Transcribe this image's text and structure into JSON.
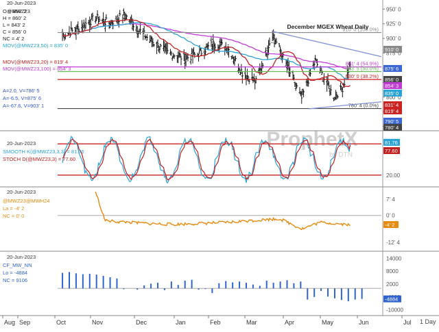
{
  "chart_data": [
    {
      "type": "candlestick",
      "panel": "price",
      "title": "December MGEX Wheat Daily",
      "date": "20-Jun-2023",
      "legend": [
        {
          "text": "@MWZ23",
          "color": "#222222"
        },
        {
          "text": "O = 860' 2",
          "color": "#222222"
        },
        {
          "text": "H = 860' 2",
          "color": "#222222"
        },
        {
          "text": "L = 843' 2",
          "color": "#222222"
        },
        {
          "text": "C = 856' 0",
          "color": "#222222"
        },
        {
          "text": "NC = 4' 2",
          "color": "#222222"
        },
        {
          "text": "MOV(@MWZ23,50) = 835' 0",
          "color": "#2aa3d6"
        },
        {
          "text": "MOV(@MWZ23,20) = 819' 4",
          "color": "#c02020"
        },
        {
          "text": "MOV(@MWZ23,100) = 854' 3",
          "color": "#c23ad6"
        },
        {
          "text": "A=2.0, V=786' 5",
          "color": "#3355cc"
        },
        {
          "text": "A=-6.5, V=875' 6",
          "color": "#3355cc"
        },
        {
          "text": "A=-67.6, V=903' 1",
          "color": "#3355cc"
        }
      ],
      "yticks": [
        "950' 0",
        "925' 0",
        "900' 0",
        "875' 0",
        "850' 0",
        "825' 0",
        "800' 0",
        "775' 0",
        "750' 0"
      ],
      "price_badges": [
        {
          "label": "910' 0",
          "color": "#888888"
        },
        {
          "label": "875' 6",
          "color": "#3a66d6"
        },
        {
          "label": "856' 0",
          "color": "#444444"
        },
        {
          "label": "854' 3",
          "color": "#c23ad6"
        },
        {
          "label": "835' 0",
          "color": "#2aa3d6"
        },
        {
          "label": "831' 4",
          "color": "#cc2222"
        },
        {
          "label": "819' 4",
          "color": "#cc2222"
        },
        {
          "label": "790' 5",
          "color": "#3a66d6"
        },
        {
          "label": "780' 4",
          "color": "#444444"
        }
      ],
      "fib_levels": [
        {
          "label": "910' 0 (100.0%)",
          "value": 910.0,
          "color": "#888888"
        },
        {
          "label": "851' 4 (54.9%)",
          "value": 851.5,
          "color": "#c23ad6"
        },
        {
          "label": "843' 5 (50.0%)",
          "value": 843.6,
          "color": "#66bb55"
        },
        {
          "label": "830' 0 (38.2%)",
          "value": 830.0,
          "color": "#cc2222"
        },
        {
          "label": "780' 4 (0.0%)",
          "value": 780.5,
          "color": "#444444"
        }
      ],
      "ylim": [
        745,
        962
      ],
      "moving_averages": [
        {
          "length": 20,
          "value": 819.5,
          "color": "#c02020"
        },
        {
          "length": 50,
          "value": 835.0,
          "color": "#2aa3d6"
        },
        {
          "length": 100,
          "value": 854.4,
          "color": "#c23ad6"
        }
      ],
      "close_series": {
        "x": [
          "2023-08-29",
          "2023-09-15",
          "2023-10-02",
          "2023-10-16",
          "2023-11-01",
          "2023-11-15",
          "2023-12-01",
          "2023-12-15",
          "2024-01-02",
          "2024-01-16",
          "2024-02-01",
          "2024-02-15",
          "2024-03-01",
          "2024-03-15",
          "2024-04-01",
          "2024-04-15",
          "2024-05-01",
          "2024-05-15",
          "2024-06-03",
          "2024-06-12",
          "2024-06-20"
        ],
        "y": [
          905,
          918,
          935,
          926,
          940,
          915,
          892,
          876,
          866,
          874,
          892,
          884,
          842,
          826,
          908,
          856,
          798,
          862,
          800,
          816,
          856
        ]
      }
    },
    {
      "type": "line",
      "panel": "stochastic",
      "date": "20-Jun-2023",
      "legend": [
        {
          "text": "SMOOTH K(@MWZ23,3,3) = 81.76",
          "color": "#2aa3d6"
        },
        {
          "text": "STOCH D(@MWZ23,3) = 77.60",
          "color": "#c02020"
        }
      ],
      "yticks": [
        "80.00",
        "20.00"
      ],
      "badges": [
        {
          "label": "81.76",
          "color": "#2aa3d6"
        },
        {
          "label": "77.60",
          "color": "#c02020"
        }
      ],
      "ylim": [
        0,
        100
      ],
      "series": [
        {
          "name": "SMOOTH K",
          "current": 81.76,
          "color": "#2aa3d6"
        },
        {
          "name": "STOCH D",
          "current": 77.6,
          "color": "#c02020"
        }
      ]
    },
    {
      "type": "line",
      "panel": "spread",
      "date": "20-Jun-2023",
      "legend": [
        {
          "text": "@MWZ23@MWH24",
          "color": "#e88a10"
        },
        {
          "text": "La = -4' 2",
          "color": "#e88a10"
        },
        {
          "text": "NC = 0' 0",
          "color": "#e88a10"
        }
      ],
      "yticks": [
        "0' 0",
        "-12' 4"
      ],
      "extra_tick": "7' 4",
      "badges": [
        {
          "label": "-4' 2",
          "color": "#e88a10"
        }
      ],
      "ylim": [
        -16,
        12
      ],
      "series": [
        {
          "name": "Dec/Mar spread",
          "current": -4.25,
          "color": "#e88a10"
        }
      ]
    },
    {
      "type": "bar",
      "panel": "cot",
      "date": "20-Jun-2023",
      "legend": [
        {
          "text": "CF_MW_NN",
          "color": "#2f63d0"
        },
        {
          "text": "Lo = -4884",
          "color": "#2f63d0"
        },
        {
          "text": "NC = 9106",
          "color": "#2f63d0"
        }
      ],
      "yticks": [
        "14000",
        "8000",
        "2000",
        "-4000",
        "-10000"
      ],
      "badges": [
        {
          "label": "-4884",
          "color": "#2f63d0"
        }
      ],
      "ylim": [
        -12000,
        16000
      ],
      "weekly_net": [
        7200,
        7600,
        7000,
        6600,
        6800,
        6400,
        5800,
        5200,
        4600,
        -400,
        0,
        -600,
        1400,
        2200,
        2600,
        -800,
        3200,
        1600,
        3600,
        4000,
        -600,
        -300,
        -2200,
        2400,
        3400,
        2800,
        3200,
        2600,
        1800,
        1200,
        3600,
        2600,
        3200,
        3800,
        2400,
        3200,
        -5200,
        -4000,
        -1200,
        -3800,
        -4600,
        -5400,
        -6000,
        -5200,
        -4884
      ]
    }
  ],
  "x_axis": {
    "months": [
      "Aug",
      "Sep",
      "Oct",
      "Nov",
      "Dec",
      "Jan",
      "Feb",
      "Mar",
      "Apr",
      "May",
      "Jun",
      "Jul"
    ],
    "interval": "1 Day"
  },
  "watermark": {
    "brand": "ProphetX",
    "byline": "by DTN"
  },
  "colors": {
    "price": "#111111",
    "ma20": "#c02020",
    "ma50": "#2aa3d6",
    "ma100": "#c23ad6",
    "trend": "#8090d8",
    "spread": "#e88a10",
    "cot": "#2f63d0"
  }
}
